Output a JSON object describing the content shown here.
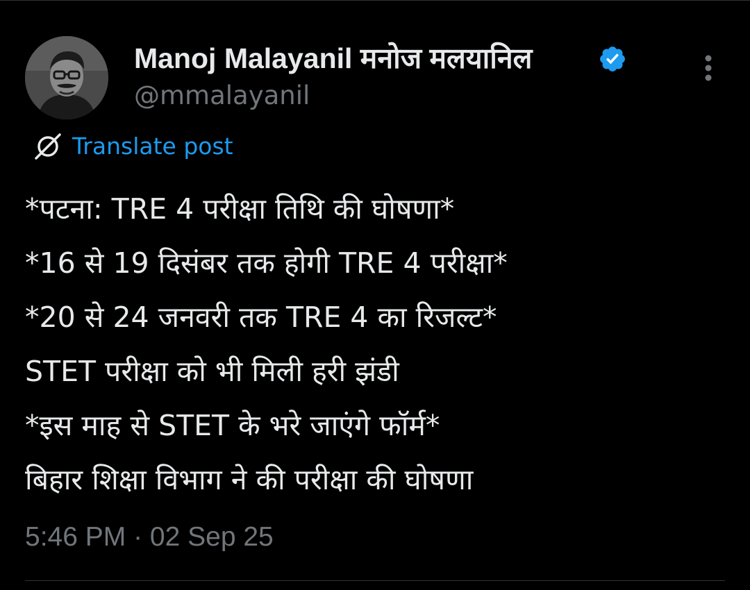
{
  "author": {
    "display_name": "Manoj Malayanil मनोज मलयानिल",
    "handle": "@mmalayanil",
    "verified": true,
    "avatar_icon": "profile-photo"
  },
  "actions": {
    "more_icon": "more-vertical-icon",
    "translate_icon": "translate-globe-icon",
    "translate_label": "Translate post"
  },
  "post": {
    "lines": [
      "*पटना: TRE 4 परीक्षा तिथि की घोषणा*",
      "*16 से 19 दिसंबर तक होगी TRE 4 परीक्षा*",
      "*20 से 24 जनवरी तक TRE 4 का रिजल्ट*",
      "STET परीक्षा को भी मिली हरी झंडी",
      "*इस माह से STET के भरे जाएंगे फॉर्म*",
      "बिहार शिक्षा विभाग ने की परीक्षा की घोषणा"
    ]
  },
  "timestamp": "5:46 PM · 02 Sep 25",
  "colors": {
    "background": "#000000",
    "primary_text": "#e7e9ea",
    "secondary_text": "#71767b",
    "accent": "#1d9bf0",
    "divider": "#2f3336"
  }
}
